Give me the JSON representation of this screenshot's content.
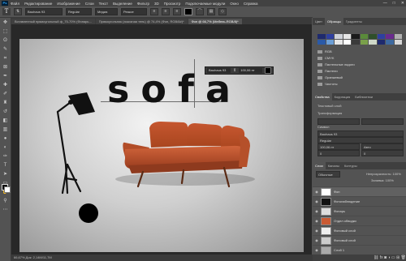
{
  "menubar": {
    "app_icon": "Ps",
    "items": [
      "Файл",
      "Редактирование",
      "Изображение",
      "Слои",
      "Текст",
      "Выделение",
      "Фильтр",
      "3D",
      "Просмотр",
      "Подключаемые модули",
      "Окно",
      "Справка"
    ],
    "controls": [
      "—",
      "□",
      "✕"
    ]
  },
  "options": {
    "tool_glyph": "T",
    "font_family": "Bauhaus 93",
    "font_style": "Regular",
    "font_size": "Медиа",
    "aa": "Резкое"
  },
  "tabs": [
    {
      "label": "Вставленный прямоугольный ф_75-70% (Фонарь..."
    },
    {
      "label": "Прямоугольник (эскизная тень) @ 74,4% (Фон, RGB/8#)*"
    },
    {
      "label": "Фон @ 66,7% (Мебель-RGB/8)*"
    }
  ],
  "canvas": {
    "headline": "sofa",
    "char_panel": {
      "font": "Bauhaus 93",
      "size": "100,06 пт"
    }
  },
  "status": "66,67%   Док: 2,14M/11,7M",
  "right": {
    "tabs1": [
      "Цвет",
      "Образцы",
      "Градиенты"
    ],
    "swatch_rows": [
      [
        "#1e2a6e",
        "#2e3fa0",
        "#cfd2d8",
        "#e6e6e6",
        "#1a1a1a",
        "#5a8b3a",
        "#2f4f2a",
        "#2e3fa0",
        "#6a2a8e",
        "#b0b0b0"
      ],
      [
        "#2a5aa8",
        "#6d9fd6",
        "#e8e8e8",
        "#ffffff",
        "#3a3a3a",
        "#7aa04a",
        "#cfd8c8",
        "#1e2a6e",
        "#3e6aa0",
        "#d8d8d8"
      ]
    ],
    "library_items": [
      "RGB",
      "CMYK",
      "Пастельные ладоги",
      "Пастели",
      "Оранжевый",
      "Чистоты"
    ],
    "tabs2": [
      "Свойства",
      "Коррекция",
      "Библиотеки"
    ],
    "properties_title": "Текстовый слой",
    "properties_section": "Трансформация",
    "props_labels": [
      "Символ",
      "Bauhaus 93",
      "Regular",
      "100,06 пт",
      "Авто",
      "0",
      "0"
    ],
    "tabs3": [
      "Слои",
      "Каналы",
      "Контуры"
    ],
    "layer_kind": "Обычные",
    "opacity": "Непрозрачность: 100%",
    "fill": "Заливка: 100%",
    "layers": [
      {
        "name": "Фон"
      },
      {
        "name": "Фотонаблюдение"
      },
      {
        "name": "Фонарь"
      },
      {
        "name": "Отдел обводки"
      },
      {
        "name": "Фоновый слой"
      },
      {
        "name": "Фоновый слой"
      },
      {
        "name": "Слой 1"
      }
    ]
  },
  "colors": {
    "sofa_orange": "#c95a33",
    "sofa_dark": "#8e3a1e",
    "photoshop_blue": "#31a8ff"
  }
}
